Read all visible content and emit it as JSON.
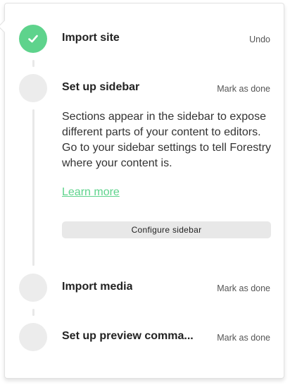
{
  "steps": [
    {
      "title": "Import site",
      "action": "Undo",
      "status": "done"
    },
    {
      "title": "Set up sidebar",
      "action": "Mark as done",
      "status": "active",
      "description": "Sections appear in the sidebar to expose different parts of your content to editors. Go to your sidebar settings to tell Forestry where your content is.",
      "link_label": "Learn more",
      "button_label": "Configure sidebar"
    },
    {
      "title": "Import media",
      "action": "Mark as done",
      "status": "pending"
    },
    {
      "title": "Set up preview comma...",
      "action": "Mark as done",
      "status": "pending"
    }
  ],
  "colors": {
    "accent": "#5ed38c",
    "pending_circle": "#ececec",
    "connector": "#e8e8e8"
  },
  "icons": {
    "done": "check-icon"
  }
}
